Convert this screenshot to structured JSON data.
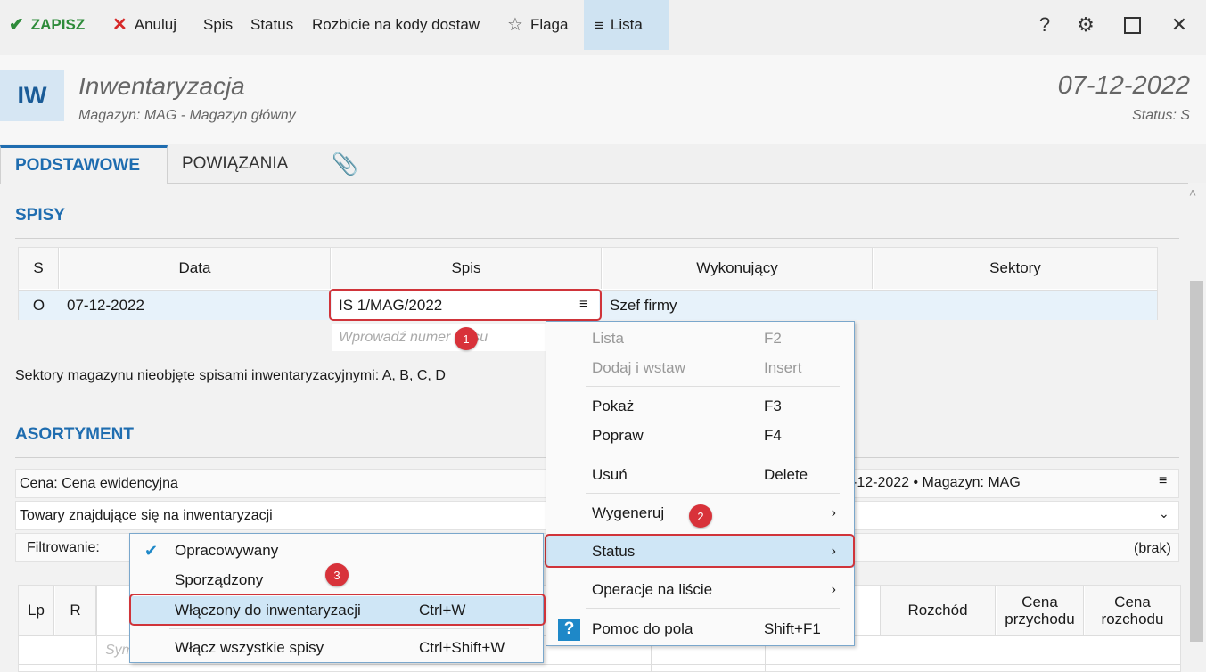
{
  "toolbar": {
    "save": "ZAPISZ",
    "cancel": "Anuluj",
    "spis": "Spis",
    "status": "Status",
    "split": "Rozbicie na kody dostaw",
    "flag": "Flaga",
    "list": "Lista",
    "help": "?"
  },
  "header": {
    "badge": "IW",
    "title": "Inwentaryzacja",
    "subtitle": "Magazyn: MAG - Magazyn główny",
    "date": "07-12-2022",
    "status": "Status: S"
  },
  "tabs": {
    "basic": "PODSTAWOWE",
    "links": "POWIĄZANIA"
  },
  "spisy": {
    "title": "SPISY",
    "columns": [
      "S",
      "Data",
      "Spis",
      "Wykonujący",
      "Sektory"
    ],
    "row": {
      "s": "O",
      "data": "07-12-2022",
      "spis": "IS 1/MAG/2022",
      "wyk": "Szef firmy",
      "sektory": ""
    },
    "placeholder": "Wprowadź numer spisu",
    "note": "Sektory magazynu nieobjęte spisami inwentaryzacyjnymi: A, B, C, D"
  },
  "asortyment": {
    "title": "ASORTYMENT",
    "price": "Cena: Cena ewidencyjna",
    "info": "-12-2022 • Magazyn: MAG",
    "filter_select": "Towary znajdujące się na inwentaryzacji",
    "filter_label": "Filtrowanie:",
    "filter_value": "(brak)",
    "columns": {
      "lp": "Lp",
      "r": "R",
      "rozchod": "Rozchód",
      "cena_p": "Cena przychodu",
      "cena_r": "Cena rozchodu"
    },
    "row_placeholder": "Sym"
  },
  "context_menu": {
    "items": [
      {
        "label": "Lista",
        "shortcut": "F2",
        "disabled": true
      },
      {
        "label": "Dodaj i wstaw",
        "shortcut": "Insert",
        "disabled": true
      },
      {
        "label": "Pokaż",
        "shortcut": "F3"
      },
      {
        "label": "Popraw",
        "shortcut": "F4"
      },
      {
        "label": "Usuń",
        "shortcut": "Delete"
      },
      {
        "label": "Wygeneruj",
        "shortcut": ""
      },
      {
        "label": "Status",
        "shortcut": ""
      },
      {
        "label": "Operacje na liście",
        "shortcut": ""
      },
      {
        "label": "Pomoc do pola",
        "shortcut": "Shift+F1"
      }
    ]
  },
  "submenu": {
    "items": [
      {
        "label": "Opracowywany",
        "shortcut": "",
        "checked": true
      },
      {
        "label": "Sporządzony",
        "shortcut": ""
      },
      {
        "label": "Włączony do inwentaryzacji",
        "shortcut": "Ctrl+W"
      },
      {
        "label": "Włącz wszystkie spisy",
        "shortcut": "Ctrl+Shift+W"
      }
    ]
  },
  "callouts": [
    "1",
    "2",
    "3"
  ],
  "colors": {
    "accent": "#1f6db0",
    "highlight": "#d0343a",
    "save_green": "#2e8b3a",
    "cancel_red": "#d62828"
  }
}
